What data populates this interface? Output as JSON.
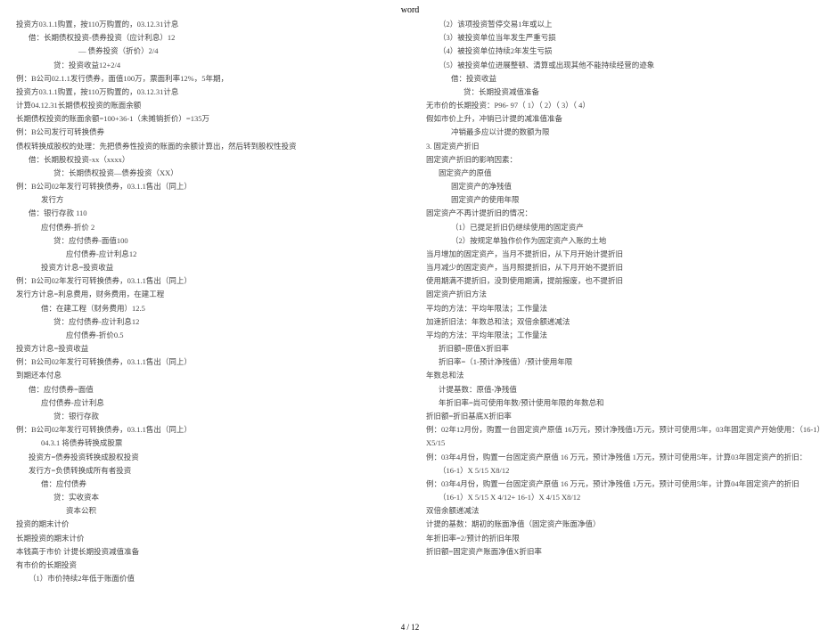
{
  "header": {
    "title": "word"
  },
  "footer": {
    "page": "4 / 12"
  },
  "left": [
    {
      "t": "投资方03.1.1购置，按110万购置的，03.12.31计息",
      "c": ""
    },
    {
      "t": "借：长期债权投资-债券投资（应计利息）12",
      "c": "i1"
    },
    {
      "t": "— 债券投资（折价）2/4",
      "c": "i5"
    },
    {
      "t": "贷：投资收益12+2/4",
      "c": "i3"
    },
    {
      "t": "例：B公司02.1.1发行债券，面值100万，票面利率12%，5年期，",
      "c": ""
    },
    {
      "t": "投资方03.1.1购置，按110万购置的，03.12.31计息",
      "c": ""
    },
    {
      "t": "计算04.12.31长期债权投资的账面余额",
      "c": ""
    },
    {
      "t": "长期债权投资的账面余额=100+36-1（未摊销折价）=135万",
      "c": ""
    },
    {
      "t": "例：B公司发行可转换债券",
      "c": ""
    },
    {
      "t": "债权转换成股权的处理：先把债券性投资的账面的余额计算出，然后转到股权性投资",
      "c": ""
    },
    {
      "t": "借：长期股权投资-xx（xxxx）",
      "c": "i1"
    },
    {
      "t": "贷：长期债权投资—债券投资（XX）",
      "c": "i3"
    },
    {
      "t": "例：B公司02年发行可转换债券，03.1.1售出（同上）",
      "c": ""
    },
    {
      "t": "发行方",
      "c": "i2"
    },
    {
      "t": "借：银行存款 110",
      "c": "i1"
    },
    {
      "t": "应付债券-折价 2",
      "c": "i2"
    },
    {
      "t": "贷：应付债券-面值100",
      "c": "i3"
    },
    {
      "t": "应付债券-应计利息12",
      "c": "i4"
    },
    {
      "t": "投资方计息=投资收益",
      "c": "i2"
    },
    {
      "t": "例：B公司02年发行可转换债券，03.1.1售出（同上）",
      "c": ""
    },
    {
      "t": "发行方计息=利息费用，财务费用，在建工程",
      "c": ""
    },
    {
      "t": "借：在建工程（财务费用）12.5",
      "c": "i2"
    },
    {
      "t": "贷：应付债券-应计利息12",
      "c": "i3"
    },
    {
      "t": "应付债券-折价0.5",
      "c": "i4"
    },
    {
      "t": "投资方计息=投资收益",
      "c": ""
    },
    {
      "t": "例：B公司02年发行可转换债券，03.1.1售出（同上）",
      "c": ""
    },
    {
      "t": "到期还本付息",
      "c": ""
    },
    {
      "t": "借：应付债券=面值",
      "c": "i1"
    },
    {
      "t": "应付债券-应计利息",
      "c": "i2"
    },
    {
      "t": "贷：银行存款",
      "c": "i3"
    },
    {
      "t": "例：B公司02年发行可转换债券，03.1.1售出（同上）",
      "c": ""
    },
    {
      "t": "04.3.1 将债券转换成股票",
      "c": "i2"
    },
    {
      "t": "投资方=债券投资转换成股权投资",
      "c": "i1"
    },
    {
      "t": "发行方=负债转换成所有者投资",
      "c": "i1"
    },
    {
      "t": "借：应付债券",
      "c": "i2"
    },
    {
      "t": "贷：实收资本",
      "c": "i3"
    },
    {
      "t": "资本公积",
      "c": "i4"
    },
    {
      "t": "投资的期末计价",
      "c": ""
    },
    {
      "t": "长期投资的期末计价",
      "c": ""
    },
    {
      "t": "本钱高于市价    计提长期投资减值准备",
      "c": ""
    },
    {
      "t": "有市价的长期投资",
      "c": ""
    },
    {
      "t": "（1）市价持续2年低于账面价值",
      "c": "i1"
    }
  ],
  "right": [
    {
      "t": "（2）该项投资暂停交易1年或以上",
      "c": "i1"
    },
    {
      "t": "（3）被投资单位当年发生严重亏损",
      "c": "i1"
    },
    {
      "t": "（4）被投资单位持续2年发生亏损",
      "c": "i1"
    },
    {
      "t": "（5）被投资单位进展整顿、清算或出现其他不能持续经营的迹象",
      "c": "i1"
    },
    {
      "t": "借：投资收益",
      "c": "i2"
    },
    {
      "t": "贷：长期投资减值准备",
      "c": "i3"
    },
    {
      "t": "无市价的长期投资：P96- 97（ 1）（ 2）（ 3）（ 4）",
      "c": ""
    },
    {
      "t": "假如市价上升，冲销已计提的减准值准备",
      "c": ""
    },
    {
      "t": "冲销最多应以计提的数额为限",
      "c": "i2"
    },
    {
      "t": "3.    固定资产折旧",
      "c": ""
    },
    {
      "t": "固定资产折旧的影响因素：",
      "c": ""
    },
    {
      "t": "固定资产的原值",
      "c": "i1"
    },
    {
      "t": "固定资产的净残值",
      "c": "i2"
    },
    {
      "t": "固定资产的使用年限",
      "c": "i2"
    },
    {
      "t": "固定资产不再计提折旧的情况：",
      "c": ""
    },
    {
      "t": "（1）已提足折旧仍继续使用的固定资产",
      "c": "i2"
    },
    {
      "t": "（2）按规定单独作价作为固定资产入账的土地",
      "c": "i2"
    },
    {
      "t": "当月增加的固定资产，当月不提折旧，从下月开始计提折旧",
      "c": ""
    },
    {
      "t": "当月减少的固定资产，当月照提折旧，从下月开始不提折旧",
      "c": ""
    },
    {
      "t": "使用期满不提折旧，没到使用期满，提前报废，也不提折旧",
      "c": ""
    },
    {
      "t": "固定资产折旧方法",
      "c": ""
    },
    {
      "t": "平均的方法：平均年限法；工作量法",
      "c": ""
    },
    {
      "t": "加速折旧法：年数总和法；双倍余额递减法",
      "c": ""
    },
    {
      "t": "平均的方法：平均年限法；工作量法",
      "c": ""
    },
    {
      "t": "折旧额=原值X折旧率",
      "c": "i1"
    },
    {
      "t": "折旧率=（1-预计净残值）/预计使用年限",
      "c": "i1"
    },
    {
      "t": "年数总和法",
      "c": ""
    },
    {
      "t": "计提基数：原值-净残值",
      "c": "i1"
    },
    {
      "t": "年折旧率=尚可使用年数/预计使用年限的年数总和",
      "c": "i1"
    },
    {
      "t": "折旧额=折旧基底X折旧率",
      "c": ""
    },
    {
      "t": "例：02年12月份，购置一台固定资产原值  16万元，预计净残值1万元，预计可使用5年，03年固定资产开始使用：（16-1）",
      "c": ""
    },
    {
      "t": "X5/15",
      "c": ""
    },
    {
      "t": "例：03年4月份，购置一台固定资产原值     16 万元，预计净残值 1万元，预计可使用5年，计算03年固定资产的折旧：",
      "c": ""
    },
    {
      "t": "（16-1）X 5/15 X8/12",
      "c": "i1"
    },
    {
      "t": "例：03年4月份，购置一台固定资产原值     16 万元，预计净残值 1万元，预计可使用5年，计算04年固定资产的折旧",
      "c": ""
    },
    {
      "t": "（16-1）X 5/15 X 4/12+ 16-1）X 4/15 X8/12",
      "c": "i1"
    },
    {
      "t": "双倍余额递减法",
      "c": ""
    },
    {
      "t": "计提的基数：期初的账面净值（固定资产账面净值）",
      "c": ""
    },
    {
      "t": "年折旧率=2/预计的折旧年限",
      "c": ""
    },
    {
      "t": "折旧额=固定资产账面净值X折旧率",
      "c": ""
    }
  ]
}
